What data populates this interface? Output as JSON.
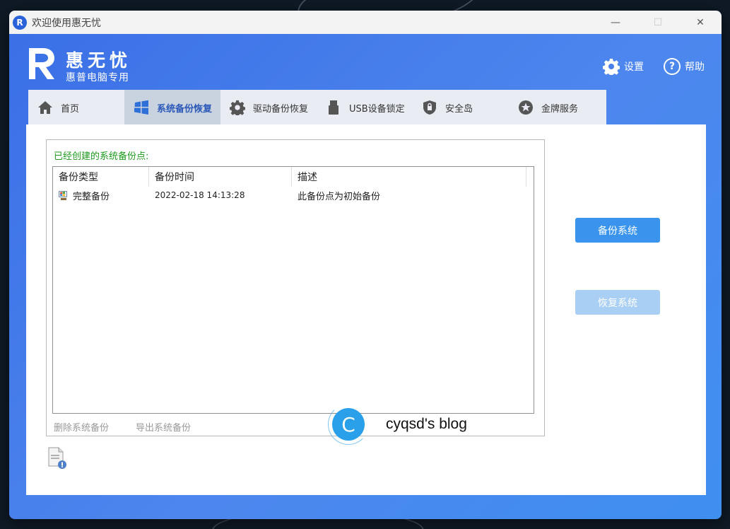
{
  "window": {
    "title": "欢迎使用惠无忧",
    "controls": [
      "—",
      "☐",
      "✕"
    ]
  },
  "header": {
    "brand_name": "惠无忧",
    "brand_sub": "惠普电脑专用",
    "settings_label": "设置",
    "help_label": "帮助"
  },
  "tabs": [
    {
      "label": "首页",
      "icon": "home-icon",
      "active": false
    },
    {
      "label": "系统备份恢复",
      "icon": "windows-icon",
      "active": true
    },
    {
      "label": "驱动备份恢复",
      "icon": "gear-icon",
      "active": false
    },
    {
      "label": "USB设备锁定",
      "icon": "usb-icon",
      "active": false
    },
    {
      "label": "安全岛",
      "icon": "lock-shield-icon",
      "active": false
    },
    {
      "label": "金牌服务",
      "icon": "star-medal-icon",
      "active": false
    }
  ],
  "backup_panel": {
    "group_title": "已经创建的系统备份点:",
    "columns": [
      "备份类型",
      "备份时间",
      "描述"
    ],
    "rows": [
      {
        "type": "完整备份",
        "time": "2022-02-18 14:13:28",
        "desc": "此备份点为初始备份"
      }
    ],
    "delete_link": "删除系统备份",
    "export_link": "导出系统备份"
  },
  "actions": {
    "backup_label": "备份系统",
    "restore_label": "恢复系统"
  },
  "watermark": {
    "letter": "C",
    "text": "cyqsd's blog"
  },
  "colors": {
    "brand_blue": "#3a6fe6",
    "button_blue": "#3a94ee",
    "button_disabled": "#a9cff4",
    "group_title_green": "#1f9a1f"
  }
}
